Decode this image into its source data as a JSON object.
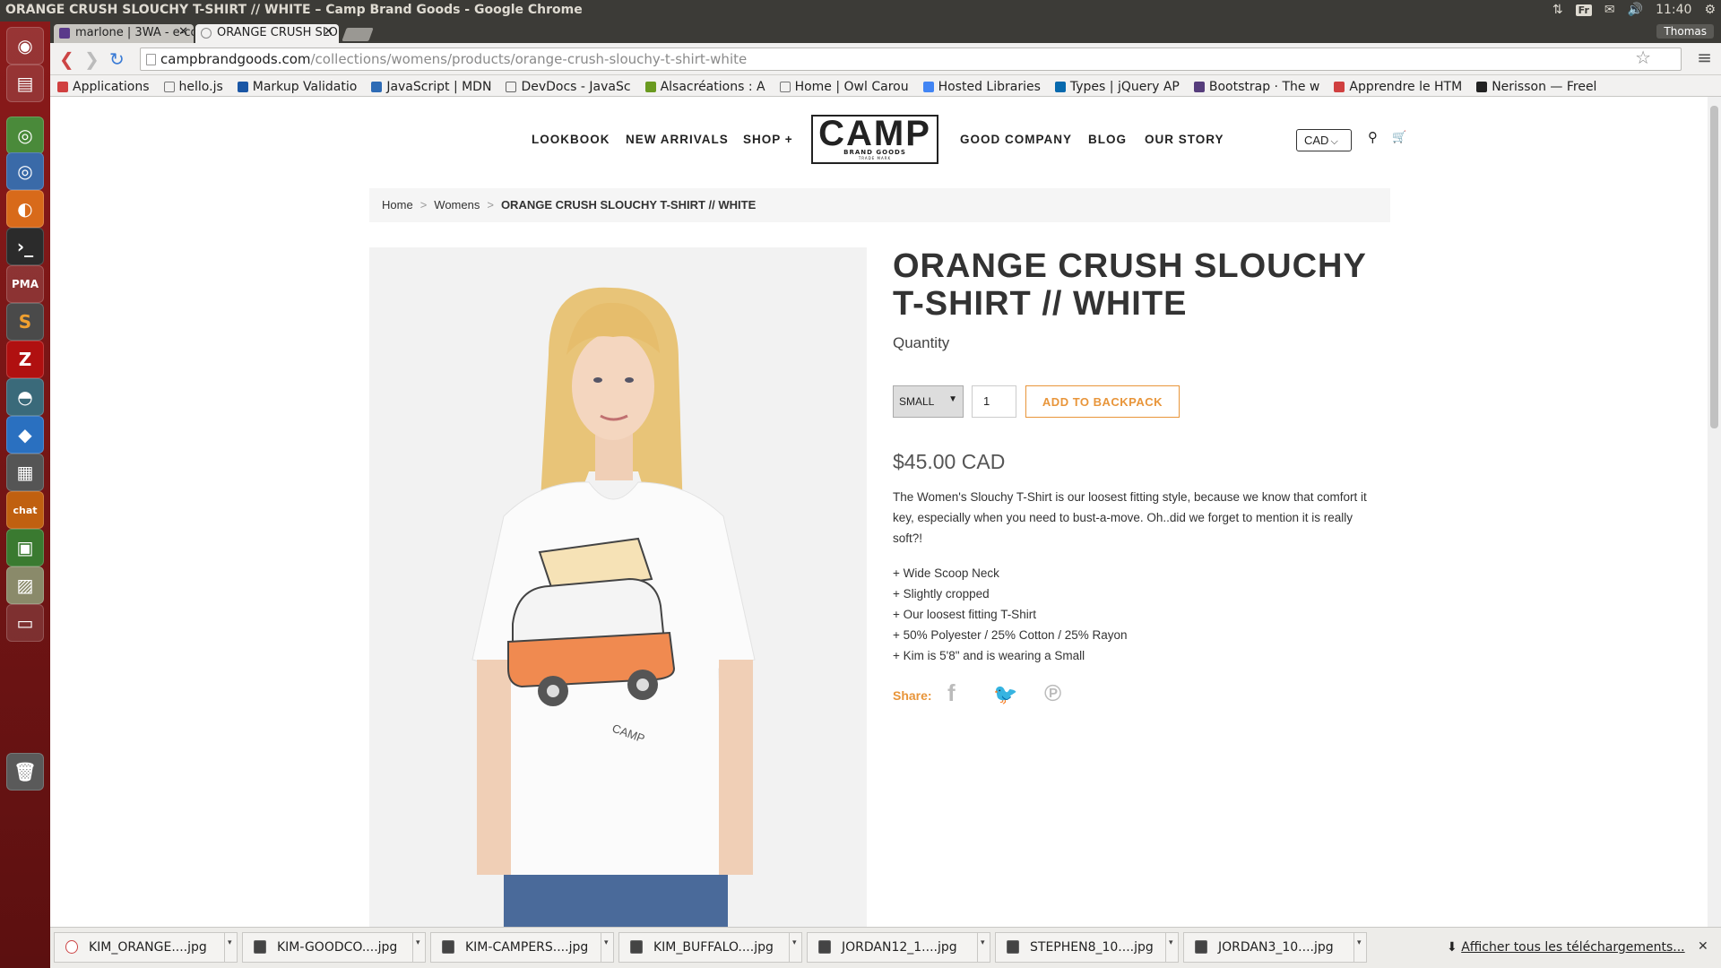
{
  "os": {
    "window_title": "ORANGE CRUSH SLOUCHY T-SHIRT // WHITE – Camp Brand Goods - Google Chrome",
    "keyboard": "Fr",
    "clock": "11:40",
    "user": "Thomas"
  },
  "tabs": [
    {
      "label": "marlone | 3WA - e-co"
    },
    {
      "label": "ORANGE CRUSH SLO"
    }
  ],
  "address": {
    "host": "campbrandgoods.com",
    "path": "/collections/womens/products/orange-crush-slouchy-t-shirt-white"
  },
  "bookmarks": [
    {
      "label": "Applications",
      "color": "#d04040"
    },
    {
      "label": "hello.js",
      "color": "#777777"
    },
    {
      "label": "Markup Validatio",
      "color": "#1a56a5"
    },
    {
      "label": "JavaScript | MDN",
      "color": "#2e6bb5"
    },
    {
      "label": "DevDocs - JavaSc",
      "color": "#666666"
    },
    {
      "label": "Alsacréations : A",
      "color": "#6a9a20"
    },
    {
      "label": "Home | Owl Carou",
      "color": "#777777"
    },
    {
      "label": "Hosted Libraries",
      "color": "#4285f4"
    },
    {
      "label": "Types | jQuery AP",
      "color": "#0769ad"
    },
    {
      "label": "Bootstrap · The w",
      "color": "#563d7c"
    },
    {
      "label": "Apprendre le HTM",
      "color": "#d04040"
    },
    {
      "label": "Nerisson — Freel",
      "color": "#222222"
    }
  ],
  "site": {
    "nav_left": [
      "LOOKBOOK",
      "NEW ARRIVALS",
      "SHOP +"
    ],
    "nav_right": [
      "GOOD COMPANY",
      "BLOG",
      "OUR STORY"
    ],
    "logo": {
      "main": "CAMP",
      "sub": "BRAND GOODS",
      "mark": "TRADE MARK"
    },
    "currency": "CAD"
  },
  "breadcrumb": {
    "home": "Home",
    "section": "Womens",
    "current": "ORANGE CRUSH SLOUCHY T-SHIRT // WHITE"
  },
  "product": {
    "title": "ORANGE CRUSH SLOUCHY T-SHIRT // WHITE",
    "quantity_label": "Quantity",
    "size": "SMALL",
    "qty": "1",
    "add_button": "ADD TO BACKPACK",
    "price": "$45.00 CAD",
    "description": "The Women's Slouchy T-Shirt is our loosest fitting style, because we know that comfort it key, especially when you need to bust-a-move. Oh..did we forget to mention it is really soft?!",
    "features": [
      "+ Wide Scoop Neck",
      "+ Slightly cropped",
      "+ Our loosest fitting T-Shirt",
      "+ 50% Polyester / 25% Cotton / 25% Rayon",
      "+ Kim is 5'8\" and is wearing a Small"
    ],
    "share_label": "Share:"
  },
  "downloads": {
    "files": [
      "KIM_ORANGE....jpg",
      "KIM-GOODCO....jpg",
      "KIM-CAMPERS....jpg",
      "KIM_BUFFALO....jpg",
      "JORDAN12_1....jpg",
      "STEPHEN8_10....jpg",
      "JORDAN3_10....jpg"
    ],
    "show_all": "Afficher tous les téléchargements..."
  }
}
